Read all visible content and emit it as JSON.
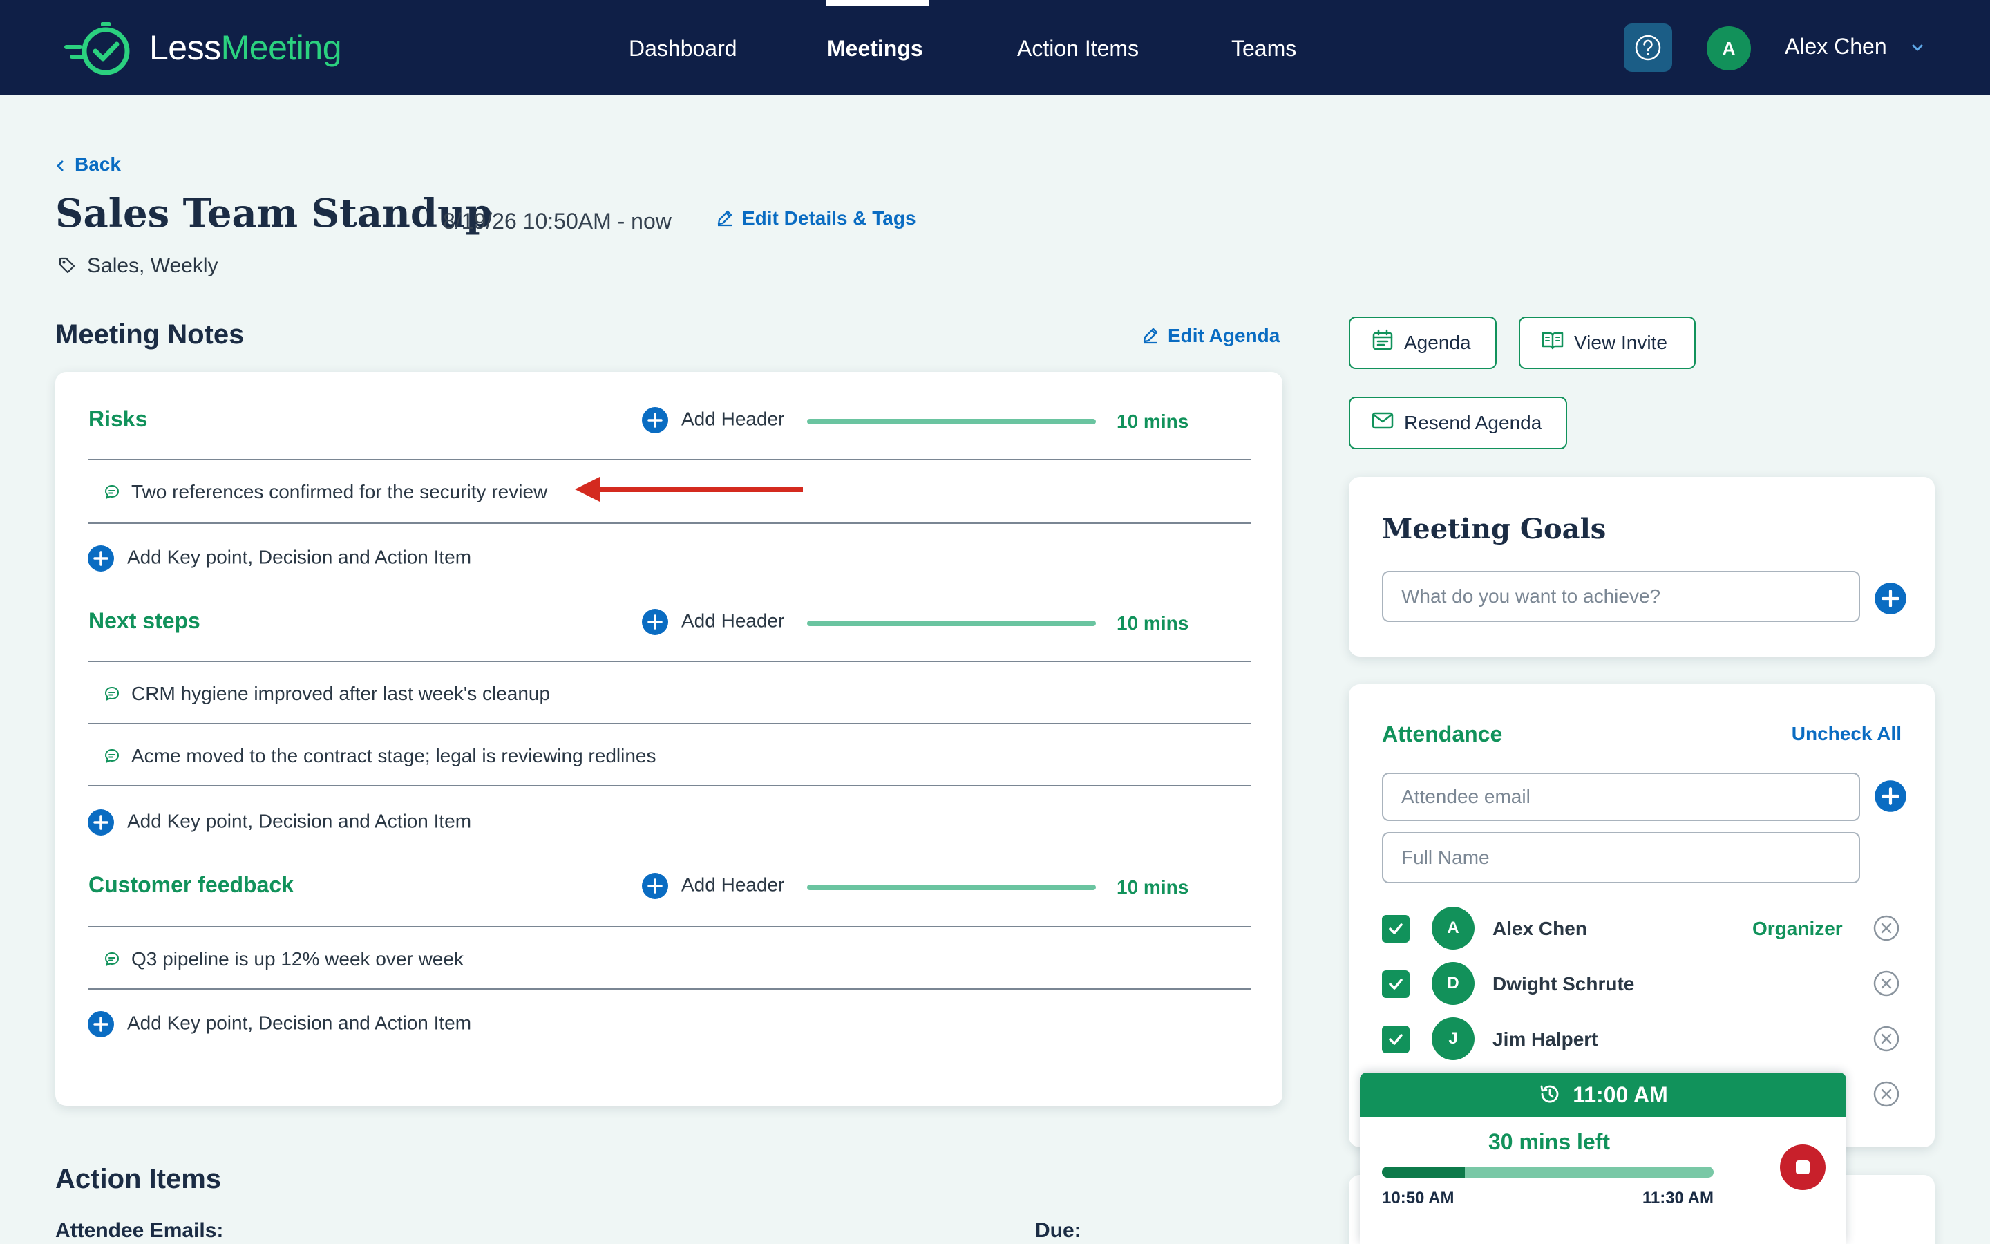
{
  "brand": {
    "name_part1": "Less",
    "name_part2": "Meeting",
    "accent_color": "#2bd17f",
    "nav_bg": "#0f1f47"
  },
  "nav": {
    "items": [
      {
        "label": "Dashboard",
        "active": false
      },
      {
        "label": "Meetings",
        "active": true
      },
      {
        "label": "Action Items",
        "active": false
      },
      {
        "label": "Teams",
        "active": false
      }
    ],
    "help_icon": "question-circle-icon",
    "user": {
      "initial": "A",
      "name": "Alex Chen"
    }
  },
  "header": {
    "back_label": "Back",
    "title": "Sales Team Standup",
    "datetime": "8/19/26 10:50AM - now",
    "edit_details_label": "Edit Details & Tags",
    "tags": "Sales, Weekly"
  },
  "notes": {
    "section_title": "Meeting Notes",
    "edit_agenda_label": "Edit Agenda",
    "add_header_label": "Add Header",
    "add_point_label": "Add Key point, Decision and Action Item",
    "topics": [
      {
        "title": "Risks",
        "duration": "10 mins",
        "items": [
          "Two references confirmed for the security review"
        ]
      },
      {
        "title": "Next steps",
        "duration": "10 mins",
        "items": [
          "CRM hygiene improved after last week's cleanup",
          "Acme moved to the contract stage; legal is reviewing redlines"
        ]
      },
      {
        "title": "Customer feedback",
        "duration": "10 mins",
        "items": [
          "Q3 pipeline is up 12% week over week"
        ]
      }
    ]
  },
  "action_items": {
    "title": "Action Items",
    "attendee_emails_label": "Attendee Emails:",
    "due_label": "Due:"
  },
  "side_buttons": {
    "agenda": "Agenda",
    "view_invite": "View Invite",
    "resend_agenda": "Resend Agenda"
  },
  "goals": {
    "title": "Meeting Goals",
    "placeholder": "What do you want to achieve?"
  },
  "attendance": {
    "title": "Attendance",
    "uncheck_all": "Uncheck All",
    "email_placeholder": "Attendee email",
    "name_placeholder": "Full Name",
    "organizer_label": "Organizer",
    "attendees": [
      {
        "initial": "A",
        "name": "Alex Chen",
        "checked": true,
        "organizer": true
      },
      {
        "initial": "D",
        "name": "Dwight Schrute",
        "checked": true,
        "organizer": false
      },
      {
        "initial": "J",
        "name": "Jim Halpert",
        "checked": true,
        "organizer": false
      }
    ]
  },
  "timer": {
    "current_time": "11:00 AM",
    "remaining": "30 mins left",
    "start": "10:50 AM",
    "end": "11:30 AM",
    "progress": 0.25
  }
}
